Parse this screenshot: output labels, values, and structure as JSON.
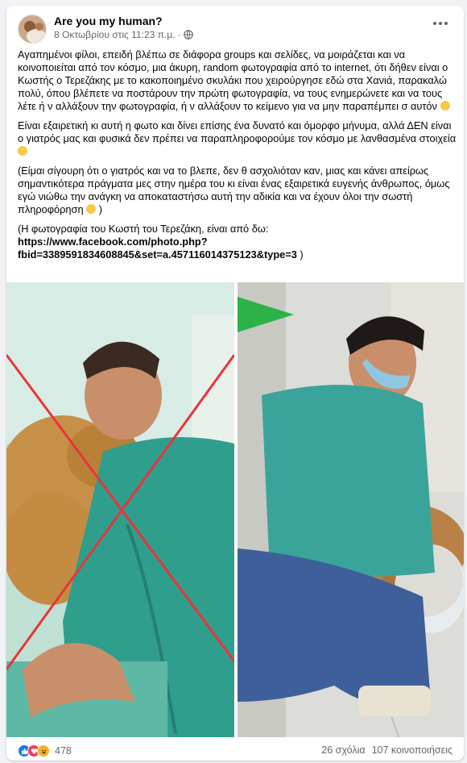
{
  "post": {
    "author": "Are you my human?",
    "timestamp": "8 Οκτωβρίου στις 11:23 π.μ.",
    "separator": "·",
    "paragraphs": [
      "Αγαπημένοι φίλοι, επειδή βλέπω σε διάφορα groups και σελίδες, να μοιράζεται και να κοινοποιείται από τον κόσμο, μια άκυρη, random φωτογραφία από το internet, ότι δήθεν είναι ο Κωστής ο Τερεζάκης με το κακοποιημένο σκυλάκι που χειρούργησε εδώ στα Χανιά, παρακαλώ πολύ, όπου βλέπετε να ποστάρουν την πρώτη φωτογραφία, να τους ενημερώνετε και να τους λέτε ή ν αλλάξουν την φωτογραφία, ή ν αλλάξουν το κείμενο για να μην παραπέμπει σ αυτόν",
      "Είναι εξαιρετική κι αυτή η φωτο και δίνει επίσης ένα δυνατό και όμορφο μήνυμα, αλλά ΔΕΝ είναι ο γιατρός μας και φυσικά δεν πρέπει να παραπληροφορούμε τον κόσμο με λανθασμένα στοιχεία",
      "(Είμαι σίγουρη ότι ο γιατρός και να το βλεπε, δεν θ ασχολιόταν καν, μιας και κάνει απείρως σημαντικότερα πράγματα μες στην ημέρα του κι είναι ένας εξαιρετικά ευγενής άνθρωπος, όμως εγώ νιώθω την ανάγκη να αποκαταστήσω αυτή την αδικία και να έχουν όλοι την σωστή πληροφόρηση",
      "(Η φωτογραφία του Κωστή του Τερεζάκη, είναι από δω:"
    ],
    "p3_close": " )",
    "link_line1": "https://www.facebook.com/photo.php?",
    "link_line2": "fbid=3389591834608845&set=a.457116014375123&type=3",
    "link_close": " )"
  },
  "footer": {
    "reaction_count": "478",
    "comments": "26 σχόλια",
    "shares": "107 κοινοποιήσεις"
  },
  "colors": {
    "cross": "#e8343a",
    "arrow": "#2bb34a",
    "scrubs": "#2f9e8c",
    "background": "#f0f2f5"
  },
  "icons": [
    "globe-icon",
    "more-options-icon",
    "like-reaction-icon",
    "love-reaction-icon",
    "haha-reaction-icon",
    "smile-emoji-icon"
  ]
}
